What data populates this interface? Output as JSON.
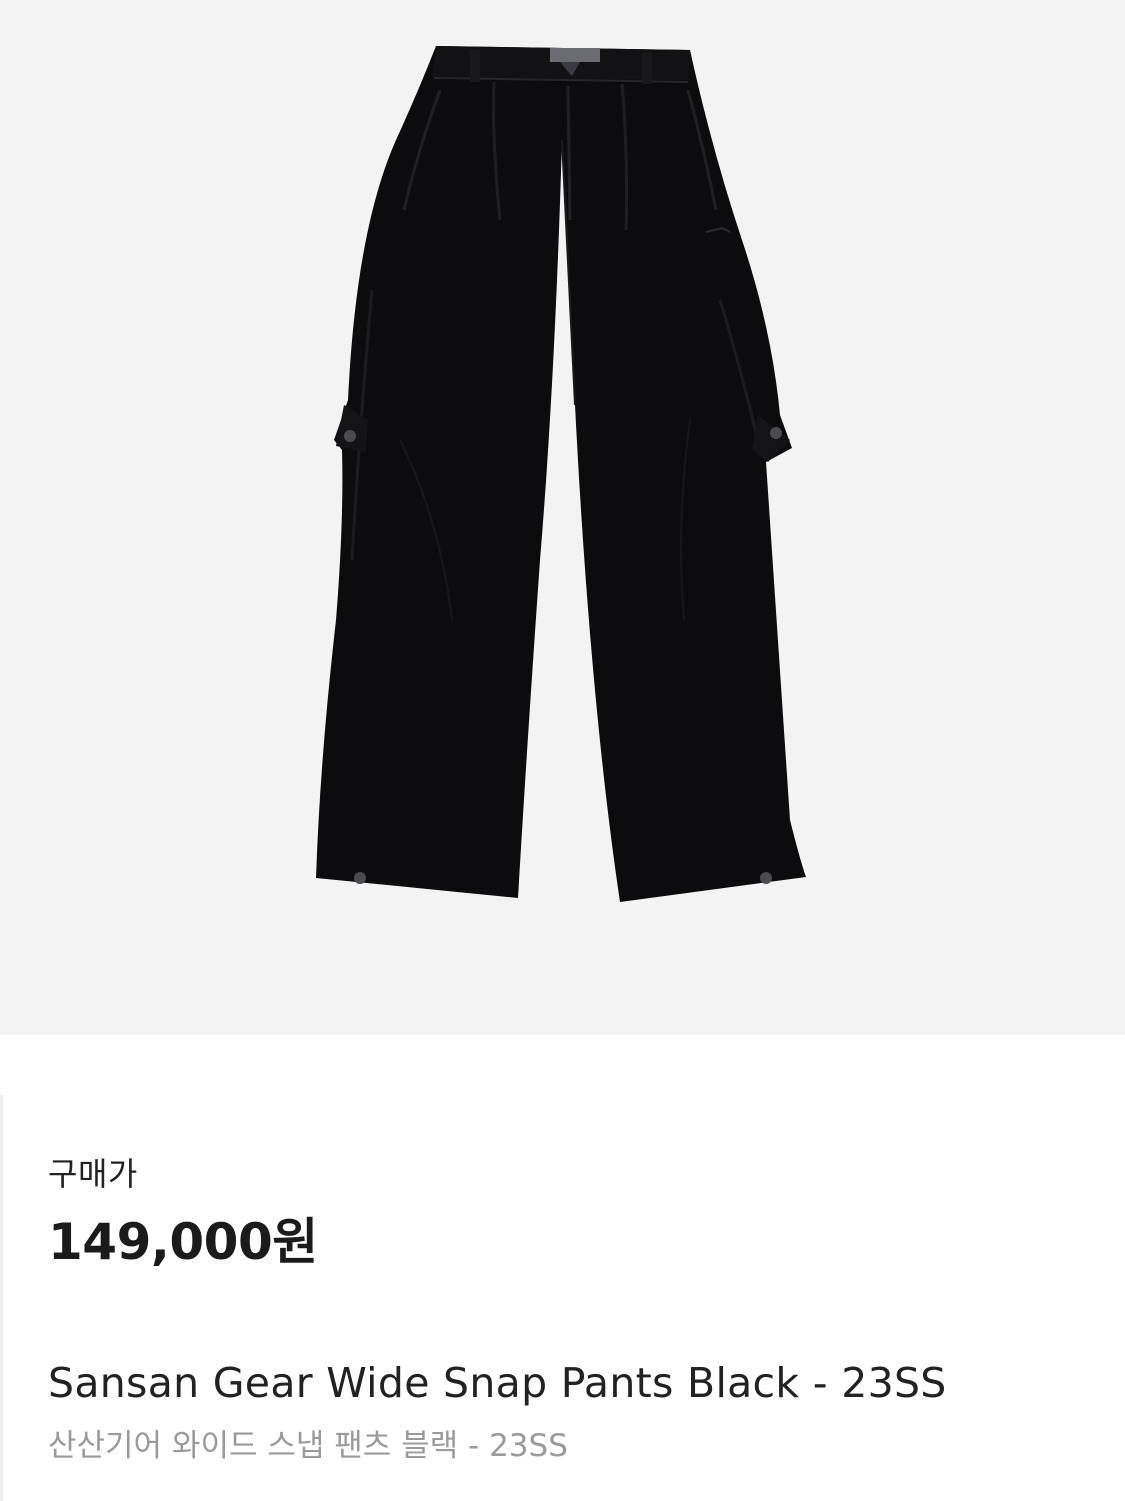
{
  "product": {
    "image_icon": "pants-image",
    "image_background": "#f3f3f3",
    "garment_color": "#0c0c0e",
    "price_label": "구매가",
    "price": "149,000원",
    "name_en": "Sansan Gear Wide Snap Pants Black - 23SS",
    "name_ko": "산산기어 와이드 스냅 팬츠 블랙 - 23SS"
  }
}
